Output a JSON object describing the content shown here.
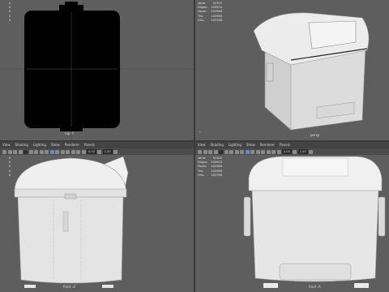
{
  "viewports": {
    "top": {
      "label": "top -Y",
      "hud": [
        {
          "key": "Verts:",
          "value": "",
          "extra": "0"
        },
        {
          "key": "Edges:",
          "value": "",
          "extra": "0"
        },
        {
          "key": "Faces:",
          "value": "",
          "extra": "0"
        },
        {
          "key": "Tris:",
          "value": "",
          "extra": "0"
        },
        {
          "key": "UVs:",
          "value": "",
          "extra": "0"
        }
      ]
    },
    "persp": {
      "label": "persp",
      "hud": [
        {
          "key": "Verts:",
          "value": "52302",
          "extra": "0"
        },
        {
          "key": "Edges:",
          "value": "105900",
          "extra": "0"
        },
        {
          "key": "Faces:",
          "value": "102966",
          "extra": "0"
        },
        {
          "key": "Tris:",
          "value": "102966",
          "extra": "0"
        },
        {
          "key": "UVs:",
          "value": "102768",
          "extra": "0"
        }
      ]
    },
    "side": {
      "label": "front -Z",
      "menu": [
        "View",
        "Shading",
        "Lighting",
        "Show",
        "Renderer",
        "Panels"
      ],
      "hud": [
        {
          "key": "Verts:",
          "value": "",
          "extra": "0"
        },
        {
          "key": "Edges:",
          "value": "",
          "extra": "0"
        },
        {
          "key": "Faces:",
          "value": "",
          "extra": "0"
        },
        {
          "key": "Tris:",
          "value": "",
          "extra": "0"
        },
        {
          "key": "UVs:",
          "value": "",
          "extra": "0"
        }
      ],
      "toolbar_values": [
        "0.00",
        "1.00"
      ]
    },
    "front": {
      "label": "front -X",
      "menu": [
        "View",
        "Shading",
        "Lighting",
        "Show",
        "Renderer",
        "Panels"
      ],
      "hud": [
        {
          "key": "Verts:",
          "value": "52302",
          "extra": "0"
        },
        {
          "key": "Edges:",
          "value": "105900",
          "extra": "0"
        },
        {
          "key": "Faces:",
          "value": "102966",
          "extra": "0"
        },
        {
          "key": "Tris:",
          "value": "102966",
          "extra": "0"
        },
        {
          "key": "UVs:",
          "value": "102768",
          "extra": "0"
        }
      ],
      "toolbar_values": [
        "0.00",
        "1.00"
      ]
    }
  },
  "colors": {
    "viewport_bg": "#5e5e5e",
    "model": "#e8e8e8",
    "silhouette": "#000000",
    "accent": "#5a8fd8"
  }
}
